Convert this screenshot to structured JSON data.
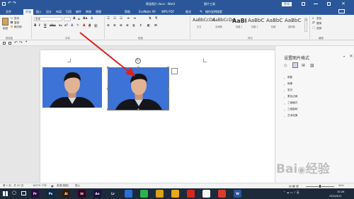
{
  "window": {
    "doc_title": "两张照片.docx - Word",
    "picture_tools": "图片工具",
    "login_btn": "登录",
    "share": "共享"
  },
  "tabs": [
    "文件",
    "开始",
    "插入",
    "设计",
    "布局",
    "引用",
    "邮件",
    "审阅",
    "视图",
    "帮助",
    "EndNote X9",
    "WPS PDF",
    "格式"
  ],
  "tell_me": "操作说明搜索",
  "ribbon": {
    "clipboard": {
      "paste": "粘贴",
      "cut": "剪切",
      "copy": "复制",
      "format_painter": "格式刷",
      "label": "剪贴板"
    },
    "font": {
      "name": "宋体",
      "size": "",
      "label": "字体"
    },
    "paragraph": {
      "label": "段落"
    },
    "styles": {
      "label": "样式",
      "items": [
        {
          "sample": "AaBbCcDd",
          "name": "正文"
        },
        {
          "sample": "AaBbCcDd",
          "name": "无间隔"
        },
        {
          "sample": "AaBl",
          "name": "标题 1"
        },
        {
          "sample": "AaBbC",
          "name": "标题 2"
        },
        {
          "sample": "AaBbC",
          "name": "标题"
        },
        {
          "sample": "AaBbC",
          "name": "副标题"
        }
      ]
    },
    "editing": {
      "find": "查找",
      "replace": "替换",
      "select": "选择",
      "label": "编辑"
    }
  },
  "format_pane": {
    "title": "设置图片格式",
    "sections": [
      "阴影",
      "映像",
      "发光",
      "柔化边缘",
      "三维格式",
      "三维旋转",
      "艺术效果"
    ]
  },
  "status": {
    "page": "第 1 页，共 20 页",
    "words": "16270 个字",
    "lang": "英语(美国)",
    "mode": "插入",
    "zoom": "94%"
  },
  "taskbar": {
    "apps": [
      {
        "label": "Pr",
        "color": "#2a0b3f"
      },
      {
        "label": "Ps",
        "color": "#0b2a4a"
      },
      {
        "label": "Ai",
        "color": "#3a1a00"
      },
      {
        "label": "Id",
        "color": "#3a0020"
      },
      {
        "label": "Ae",
        "color": "#1a1040"
      },
      {
        "label": "Lr",
        "color": "#1c2a40"
      },
      {
        "label": "",
        "color": "#2a6fd6"
      },
      {
        "label": "",
        "color": "#2bb24c"
      },
      {
        "label": "",
        "color": "#d9a21a"
      },
      {
        "label": "",
        "color": "#e8a81c"
      },
      {
        "label": "",
        "color": "#d7261c"
      },
      {
        "label": "",
        "color": "#f5f5f5"
      },
      {
        "label": "",
        "color": "#d93d2a"
      },
      {
        "label": "W",
        "color": "#2b579a"
      }
    ],
    "time": "10:26",
    "date": "2020/4/12"
  },
  "colors": {
    "accent": "#2b579a",
    "photo_bg": "#3d72d6",
    "arrow": "#d9221c"
  }
}
